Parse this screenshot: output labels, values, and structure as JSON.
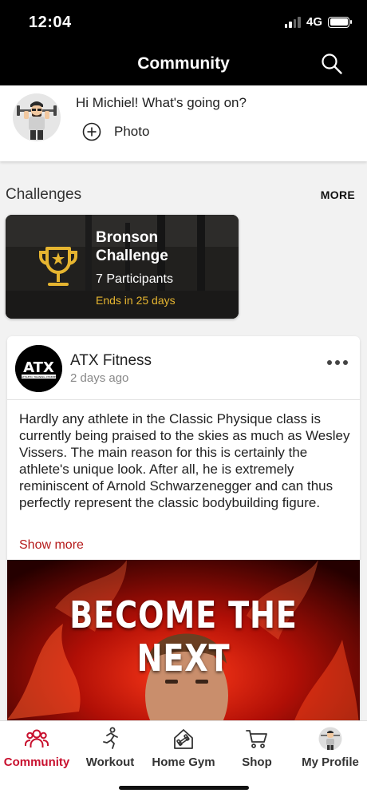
{
  "status_bar": {
    "time": "12:04",
    "network": "4G"
  },
  "nav": {
    "title": "Community",
    "search_icon": "search-icon"
  },
  "composer": {
    "greeting": "Hi Michiel! What's going on?",
    "photo_label": "Photo"
  },
  "challenges": {
    "section_title": "Challenges",
    "more_label": "MORE",
    "card": {
      "title": "Bronson Challenge",
      "participants": "7 Participants",
      "ends": "Ends in 25 days",
      "accent_color": "#e6b530"
    }
  },
  "post": {
    "author": "ATX Fitness",
    "avatar_logo_text": "ATX",
    "avatar_logo_subtext": "ATHLETIC TRAINING XTREME",
    "time_ago": "2 days ago",
    "body": "Hardly any athlete in the Classic Physique class is currently being praised to the skies as much as Wesley Vissers. The main reason for this is certainly the athlete's unique look. After all, he is extremely reminiscent of Arnold Schwarzenegger and can thus perfectly represent the classic bodybuilding figure.",
    "show_more_label": "Show more",
    "image_headline": "BECOME THE NEXT"
  },
  "tabbar": {
    "active_color": "#c8102e",
    "tabs": [
      {
        "label": "Community",
        "icon": "community-icon"
      },
      {
        "label": "Workout",
        "icon": "workout-icon"
      },
      {
        "label": "Home Gym",
        "icon": "home-gym-icon"
      },
      {
        "label": "Shop",
        "icon": "shop-icon"
      },
      {
        "label": "My Profile",
        "icon": "profile-avatar"
      }
    ]
  }
}
